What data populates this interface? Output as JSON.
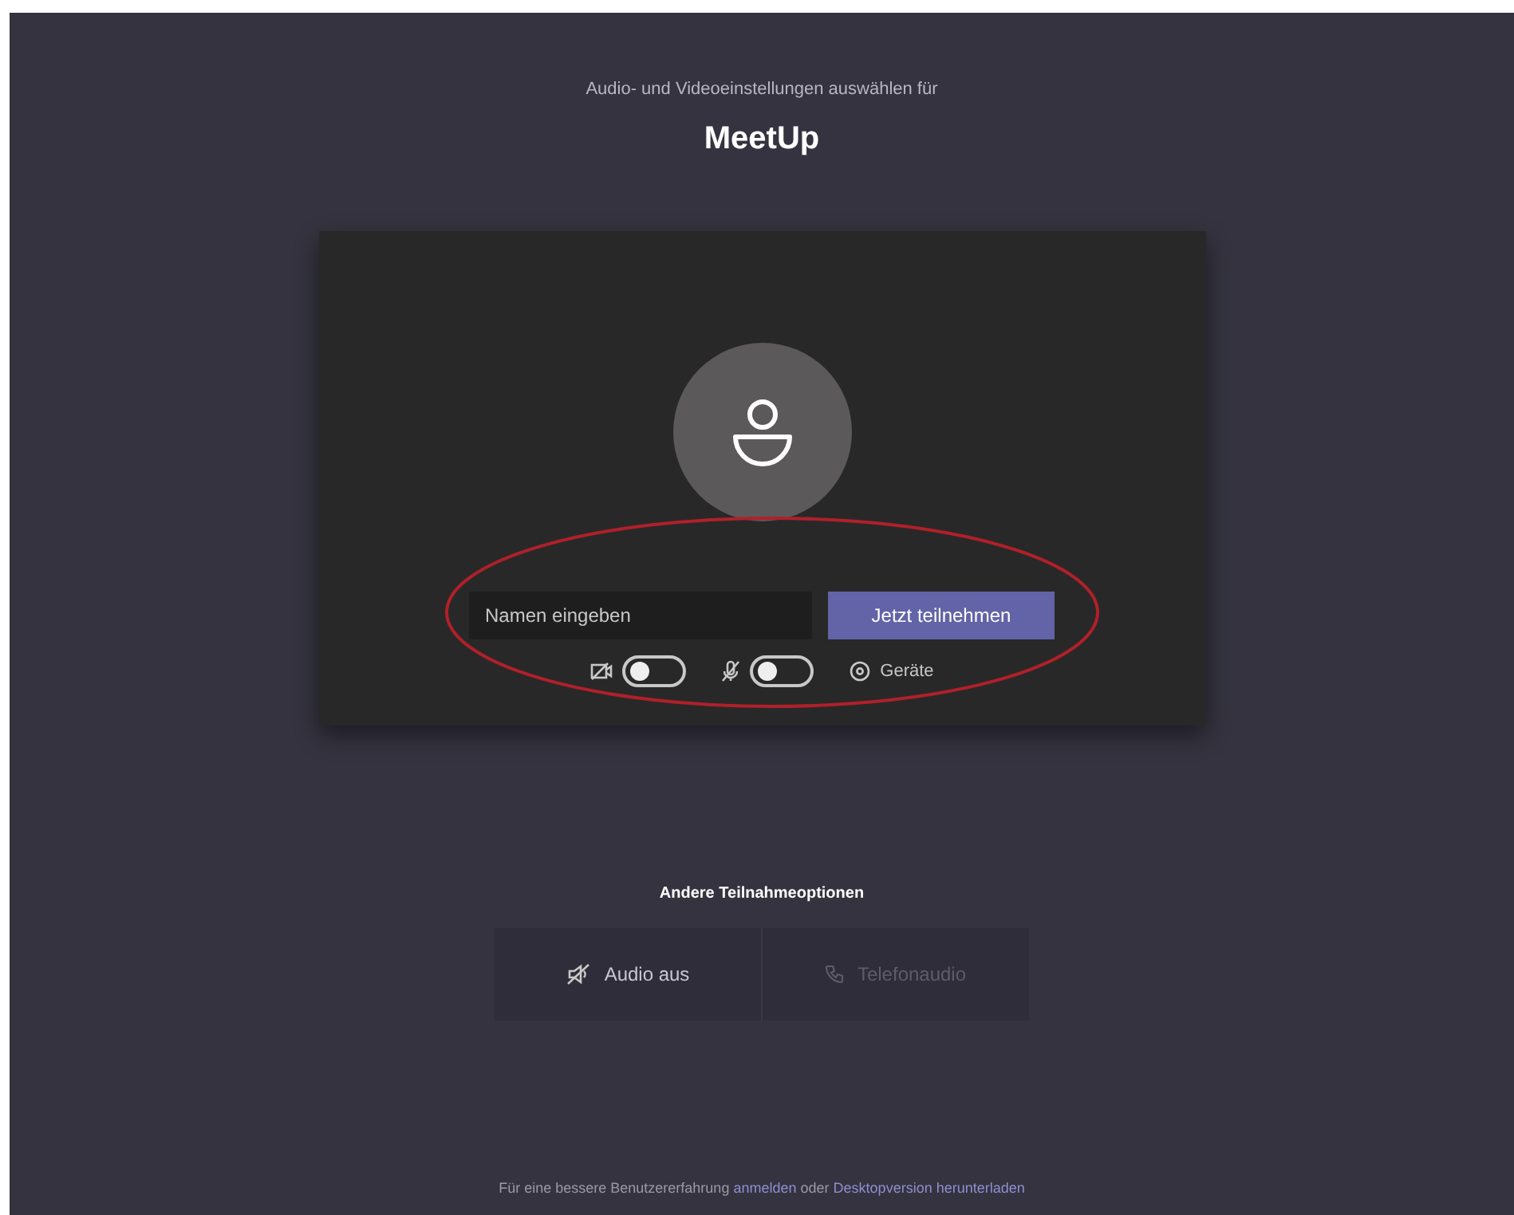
{
  "header": {
    "subtitle": "Audio- und Videoeinstellungen auswählen für",
    "title": "MeetUp"
  },
  "preview": {
    "name_field": {
      "placeholder": "Namen eingeben"
    },
    "join_button": "Jetzt teilnehmen",
    "controls": [
      {
        "kind": "camera",
        "on": false
      },
      {
        "kind": "microphone",
        "on": false
      },
      {
        "kind": "devices",
        "label": "Geräte"
      }
    ]
  },
  "other_options": {
    "title": "Andere Teilnahmeoptionen",
    "options": [
      {
        "kind": "audio_off",
        "label": "Audio aus",
        "disabled": false
      },
      {
        "kind": "phone",
        "label": "Telefonaudio",
        "disabled": true
      }
    ]
  },
  "footer": {
    "parts": [
      {
        "kind": "text",
        "text": "Für eine bessere Benutzererfahrung"
      },
      {
        "kind": "link",
        "text": "anmelden"
      },
      {
        "kind": "text",
        "text": "oder"
      },
      {
        "kind": "link",
        "text": "Desktopversion herunterladen"
      }
    ]
  },
  "annotation": {
    "kind": "ellipse",
    "color": "#b0202a"
  }
}
